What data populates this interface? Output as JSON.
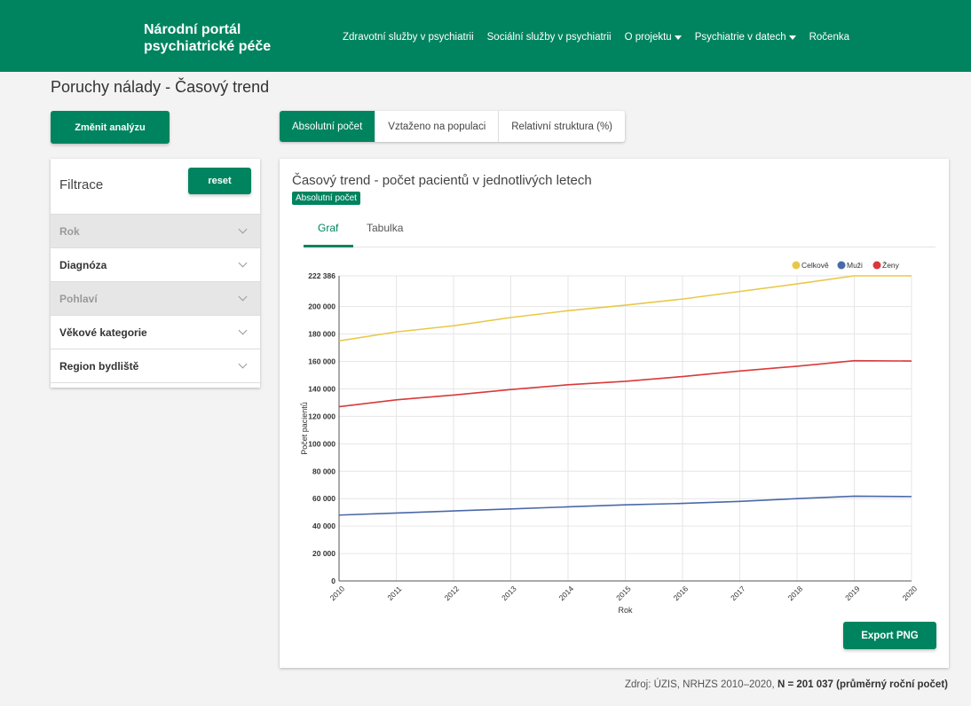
{
  "header": {
    "brand_line1": "Národní portál",
    "brand_line2": "psychiatrické péče",
    "nav": [
      {
        "label": "Zdravotní služby v psychiatrii"
      },
      {
        "label": "Sociální služby v psychiatrii"
      },
      {
        "label": "O projektu"
      },
      {
        "label": "Psychiatrie v datech"
      },
      {
        "label": "Ročenka"
      }
    ]
  },
  "page": {
    "title": "Poruchy nálady - Časový trend"
  },
  "sidebar": {
    "change_button": "Změnit analýzu",
    "filter_title": "Filtrace",
    "reset_label": "reset",
    "filters": [
      {
        "label": "Rok",
        "disabled": true
      },
      {
        "label": "Diagnóza",
        "disabled": false
      },
      {
        "label": "Pohlaví",
        "disabled": true
      },
      {
        "label": "Věkové kategorie",
        "disabled": false
      },
      {
        "label": "Region bydliště",
        "disabled": false
      }
    ]
  },
  "segments": [
    {
      "label": "Absolutní počet",
      "active": true
    },
    {
      "label": "Vztaženo na populaci",
      "active": false
    },
    {
      "label": "Relativní struktura (%)",
      "active": false
    }
  ],
  "card": {
    "title": "Časový trend - počet pacientů v jednotlivých letech",
    "badge": "Absolutní počet",
    "tabs": [
      {
        "label": "Graf",
        "active": true
      },
      {
        "label": "Tabulka",
        "active": false
      }
    ],
    "export_label": "Export PNG"
  },
  "chart_data": {
    "type": "line",
    "x": [
      2010,
      2011,
      2012,
      2013,
      2014,
      2015,
      2016,
      2017,
      2018,
      2019,
      2020
    ],
    "series": [
      {
        "name": "Celkově",
        "color": "#e8c84a",
        "values": [
          175000,
          181500,
          186000,
          192000,
          197000,
          201000,
          205500,
          211000,
          216500,
          222386,
          222386
        ]
      },
      {
        "name": "Muži",
        "color": "#4a69a8",
        "values": [
          48000,
          49500,
          51000,
          52500,
          54000,
          55500,
          56500,
          58000,
          60000,
          61800,
          61500
        ]
      },
      {
        "name": "Ženy",
        "color": "#d9393a",
        "values": [
          127000,
          132000,
          135500,
          139500,
          143000,
          145500,
          149000,
          153000,
          156500,
          160500,
          160300
        ]
      }
    ],
    "xlabel": "Rok",
    "ylabel": "Počet pacientů",
    "yticks": [
      0,
      20000,
      40000,
      60000,
      80000,
      100000,
      120000,
      140000,
      160000,
      180000,
      200000,
      222386
    ],
    "ytick_labels": [
      "0",
      "20 000",
      "40 000",
      "60 000",
      "80 000",
      "100 000",
      "120 000",
      "140 000",
      "160 000",
      "180 000",
      "200 000",
      "222 386"
    ],
    "ylim": [
      0,
      222386
    ],
    "grid": true,
    "legend": "top-right"
  },
  "footer": {
    "source_prefix": "Zdroj: ÚZIS, NRHZS 2010–2020, ",
    "source_bold": "N = 201 037 (průměrný roční počet)"
  }
}
